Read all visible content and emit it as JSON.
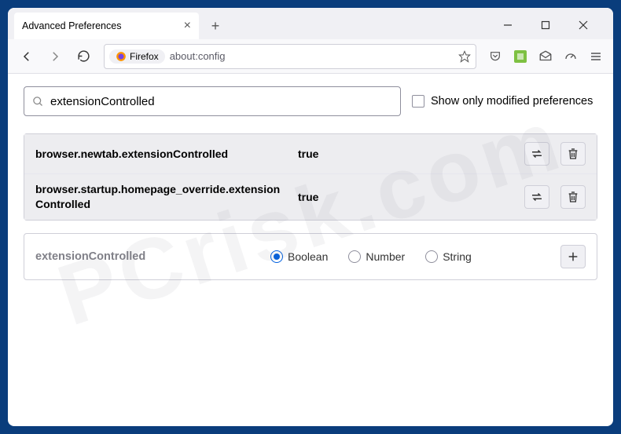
{
  "window": {
    "tab_title": "Advanced Preferences",
    "url_badge_text": "Firefox",
    "url_text": "about:config"
  },
  "search": {
    "value": "extensionControlled",
    "checkbox_label": "Show only modified preferences"
  },
  "prefs": [
    {
      "name": "browser.newtab.extensionControlled",
      "value": "true"
    },
    {
      "name": "browser.startup.homepage_override.extensionControlled",
      "value": "true"
    }
  ],
  "add": {
    "name": "extensionControlled",
    "options": {
      "boolean": "Boolean",
      "number": "Number",
      "string": "String"
    },
    "selected": "boolean"
  },
  "watermark": "PCrisk.com"
}
